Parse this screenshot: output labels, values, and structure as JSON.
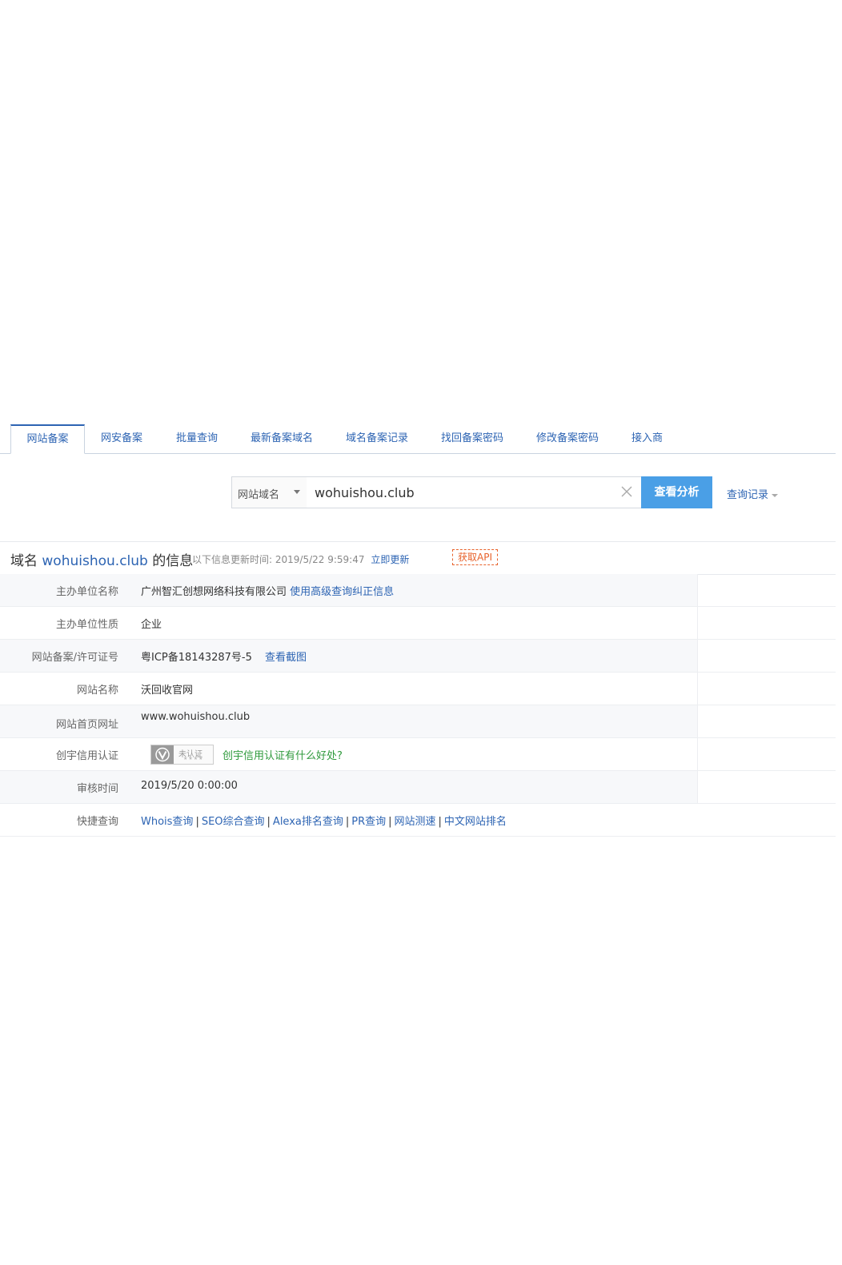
{
  "tabs": [
    {
      "label": "网站备案",
      "active": true
    },
    {
      "label": "网安备案"
    },
    {
      "label": "批量查询"
    },
    {
      "label": "最新备案域名"
    },
    {
      "label": "域名备案记录"
    },
    {
      "label": "找回备案密码"
    },
    {
      "label": "修改备案密码"
    },
    {
      "label": "接入商"
    }
  ],
  "search": {
    "type_selected": "网站域名",
    "value": "wohuishou.club",
    "button_label": "查看分析",
    "history_label": "查询记录"
  },
  "info": {
    "title_prefix": "域名",
    "domain": "wohuishou.club",
    "title_suffix": "的信息",
    "update_prefix": "以下信息更新时间:",
    "update_time": "2019/5/22 9:59:47",
    "refresh_label": "立即更新",
    "api_label": "获取API"
  },
  "rows": {
    "sponsor_name": {
      "label": "主办单位名称",
      "value": "广州智汇创想网络科技有限公司",
      "link": "使用高级查询纠正信息"
    },
    "sponsor_type": {
      "label": "主办单位性质",
      "value": "企业"
    },
    "license": {
      "label": "网站备案/许可证号",
      "value": "粤ICP备18143287号-5",
      "link": "查看截图"
    },
    "site_name": {
      "label": "网站名称",
      "value": "沃回收官网"
    },
    "homepage": {
      "label": "网站首页网址",
      "value": "www.wohuishou.club"
    },
    "credit": {
      "label": "创宇信用认证",
      "badge_text": "未认证",
      "badge_stars": "★★★★",
      "link": "创宇信用认证有什么好处?"
    },
    "review_time": {
      "label": "审核时间",
      "value": "2019/5/20 0:00:00"
    },
    "quick": {
      "label": "快捷查询",
      "links": [
        "Whois查询",
        "SEO综合查询",
        "Alexa排名查询",
        "PR查询",
        "网站测速",
        "中文网站排名"
      ],
      "separator": "|"
    }
  },
  "colors": {
    "link": "#2d64b3",
    "button": "#4a9fe6",
    "api": "#e8622b",
    "green_link": "#2f9a3c"
  }
}
